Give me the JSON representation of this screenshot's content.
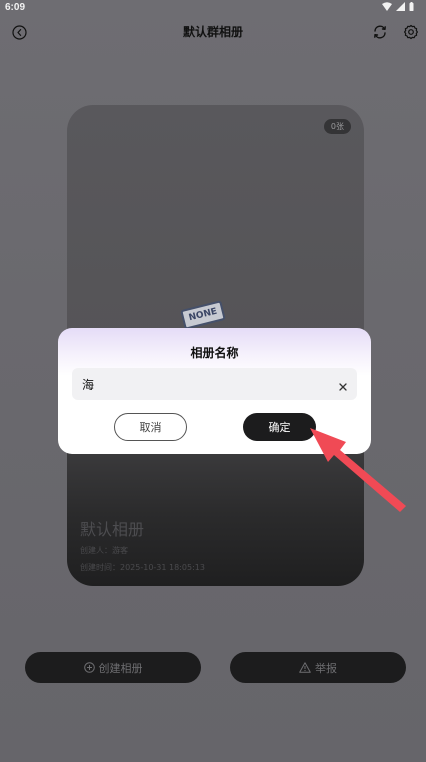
{
  "status_bar": {
    "time": "6:09"
  },
  "header": {
    "title": "默认群相册"
  },
  "album_card": {
    "count_badge": "0张",
    "placeholder_stamp": "NONE",
    "name": "默认相册",
    "creator": "创建人：游客",
    "created_time": "创建时间：2025-10-31 18:05:13"
  },
  "actions": {
    "create_label": "创建相册",
    "report_label": "举报"
  },
  "dialog": {
    "title": "相册名称",
    "input_value": "海",
    "cancel_label": "取消",
    "confirm_label": "确定"
  },
  "colors": {
    "annotation_arrow": "#f04a55",
    "dialog_header_tint": "#e5dcf7",
    "confirm_button": "#1c1c1d"
  }
}
